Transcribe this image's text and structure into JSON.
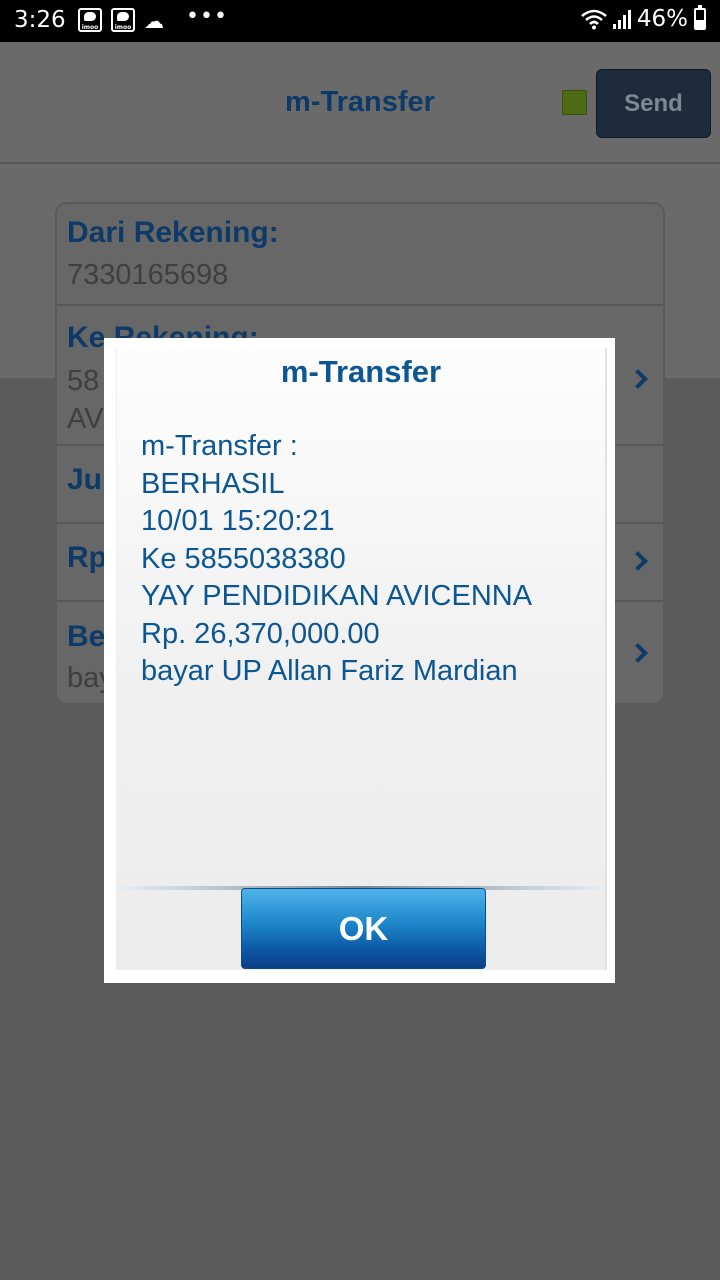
{
  "status_bar": {
    "time": "3:26",
    "imoo_label": "imoo",
    "battery": "46%",
    "battery_level": 0.46,
    "icons": [
      "imoo-icon",
      "imoo-icon",
      "cloud-upload-icon",
      "more-dots-icon",
      "wifi-icon",
      "signal-icon",
      "battery-icon"
    ]
  },
  "header": {
    "title": "m-Transfer",
    "send_label": "Send",
    "indicator_color": "#5ea615"
  },
  "form": {
    "dari_label": "Dari Rekening:",
    "dari_value": "7330165698",
    "ke_label": "Ke Rekening:",
    "ke_value_line1": "58",
    "ke_value_line2": "AV",
    "jumlah_label": "Ju",
    "rp_label": "Rp",
    "berita_label": "Be",
    "berita_value": "bay"
  },
  "dialog": {
    "title": "m-Transfer",
    "lines": [
      "m-Transfer :",
      "BERHASIL",
      "10/01 15:20:21",
      "Ke 5855038380",
      "YAY PENDIDIKAN AVICENNA",
      "Rp. 26,370,000.00",
      "bayar UP Allan Fariz Mardian"
    ],
    "ok_label": "OK"
  },
  "colors": {
    "dialog_text": "#0b5693",
    "ok_button": "#1c85c8",
    "status_bar": "#000000"
  }
}
